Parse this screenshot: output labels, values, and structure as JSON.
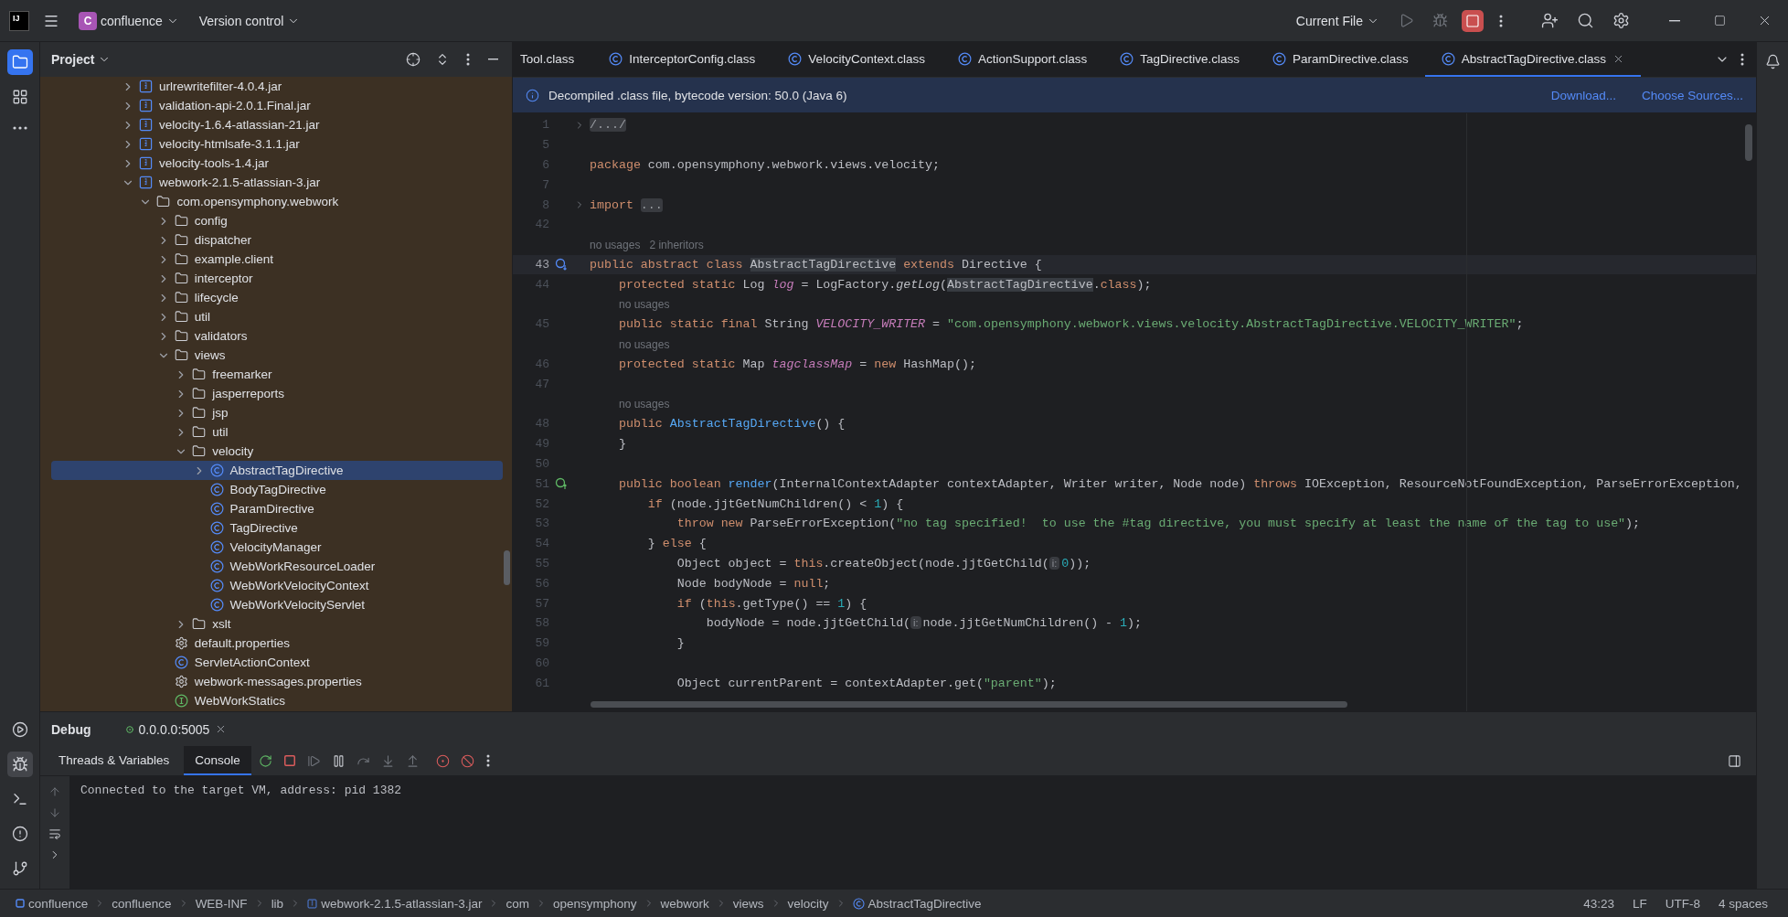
{
  "title_bar": {
    "logo": "IJ",
    "project_initial": "C",
    "project": "confluence",
    "vcs": "Version control",
    "run_config": "Current File"
  },
  "project_panel": {
    "title": "Project",
    "tree": [
      {
        "label": "urlrewritefilter-4.0.4.jar",
        "kind": "jar",
        "expanded": false,
        "selected": false
      },
      {
        "label": "validation-api-2.0.1.Final.jar",
        "kind": "jar",
        "expanded": false,
        "selected": false
      },
      {
        "label": "velocity-1.6.4-atlassian-21.jar",
        "kind": "jar",
        "expanded": false,
        "selected": false
      },
      {
        "label": "velocity-htmlsafe-3.1.1.jar",
        "kind": "jar",
        "expanded": false,
        "selected": false
      },
      {
        "label": "velocity-tools-1.4.jar",
        "kind": "jar",
        "expanded": false,
        "selected": false
      },
      {
        "label": "webwork-2.1.5-atlassian-3.jar",
        "kind": "jar",
        "expanded": true,
        "selected": false,
        "children": [
          {
            "label": "com.opensymphony.webwork",
            "kind": "package",
            "expanded": true,
            "selected": false,
            "children": [
              {
                "label": "config",
                "kind": "package",
                "expanded": false,
                "selected": false
              },
              {
                "label": "dispatcher",
                "kind": "package",
                "expanded": false,
                "selected": false
              },
              {
                "label": "example.client",
                "kind": "package",
                "expanded": false,
                "selected": false
              },
              {
                "label": "interceptor",
                "kind": "package",
                "expanded": false,
                "selected": false
              },
              {
                "label": "lifecycle",
                "kind": "package",
                "expanded": false,
                "selected": false
              },
              {
                "label": "util",
                "kind": "package",
                "expanded": false,
                "selected": false
              },
              {
                "label": "validators",
                "kind": "package",
                "expanded": false,
                "selected": false
              },
              {
                "label": "views",
                "kind": "package",
                "expanded": true,
                "selected": false,
                "children": [
                  {
                    "label": "freemarker",
                    "kind": "package",
                    "expanded": false,
                    "selected": false
                  },
                  {
                    "label": "jasperreports",
                    "kind": "package",
                    "expanded": false,
                    "selected": false
                  },
                  {
                    "label": "jsp",
                    "kind": "package",
                    "expanded": false,
                    "selected": false
                  },
                  {
                    "label": "util",
                    "kind": "package",
                    "expanded": false,
                    "selected": false
                  },
                  {
                    "label": "velocity",
                    "kind": "package",
                    "expanded": true,
                    "selected": false,
                    "children": [
                      {
                        "label": "AbstractTagDirective",
                        "kind": "class",
                        "expanded": false,
                        "selected": true
                      },
                      {
                        "label": "BodyTagDirective",
                        "kind": "class",
                        "selected": false
                      },
                      {
                        "label": "ParamDirective",
                        "kind": "class",
                        "selected": false
                      },
                      {
                        "label": "TagDirective",
                        "kind": "class",
                        "selected": false
                      },
                      {
                        "label": "VelocityManager",
                        "kind": "class",
                        "selected": false
                      },
                      {
                        "label": "WebWorkResourceLoader",
                        "kind": "class",
                        "selected": false
                      },
                      {
                        "label": "WebWorkVelocityContext",
                        "kind": "class",
                        "selected": false
                      },
                      {
                        "label": "WebWorkVelocityServlet",
                        "kind": "class",
                        "selected": false
                      }
                    ]
                  },
                  {
                    "label": "xslt",
                    "kind": "package",
                    "expanded": false,
                    "selected": false
                  }
                ]
              },
              {
                "label": "default.properties",
                "kind": "properties",
                "selected": false
              },
              {
                "label": "ServletActionContext",
                "kind": "class",
                "selected": false
              },
              {
                "label": "webwork-messages.properties",
                "kind": "properties",
                "selected": false
              },
              {
                "label": "WebWorkStatics",
                "kind": "interface",
                "selected": false
              }
            ]
          }
        ]
      }
    ]
  },
  "editor": {
    "tabs": [
      {
        "label": "Tool.class",
        "kind": "partial",
        "selected": false
      },
      {
        "label": "InterceptorConfig.class",
        "kind": "class",
        "selected": false
      },
      {
        "label": "VelocityContext.class",
        "kind": "class",
        "selected": false
      },
      {
        "label": "ActionSupport.class",
        "kind": "class",
        "selected": false
      },
      {
        "label": "TagDirective.class",
        "kind": "class",
        "selected": false
      },
      {
        "label": "ParamDirective.class",
        "kind": "class",
        "selected": false
      },
      {
        "label": "AbstractTagDirective.class",
        "kind": "class",
        "selected": true
      }
    ],
    "banner": {
      "message": "Decompiled .class file, bytecode version: 50.0 (Java 6)",
      "links": [
        "Download...",
        "Choose Sources..."
      ]
    },
    "lines": [
      {
        "kind": "code",
        "number": "1",
        "current": false,
        "tokens": [
          {
            "kind": "folded",
            "text": "/.../"
          }
        ]
      },
      {
        "kind": "code",
        "number": "5",
        "current": false
      },
      {
        "kind": "code",
        "number": "6",
        "current": false,
        "tokens": [
          {
            "kind": "keyword",
            "text": "package "
          },
          {
            "kind": "plain",
            "text": "com.opensymphony.webwork.views.velocity;"
          }
        ]
      },
      {
        "kind": "code",
        "number": "7",
        "current": false
      },
      {
        "kind": "code",
        "number": "8",
        "current": false,
        "tokens": [
          {
            "kind": "keyword",
            "text": "import "
          },
          {
            "kind": "folded",
            "text": "..."
          }
        ]
      },
      {
        "kind": "code",
        "number": "42",
        "current": false
      },
      {
        "kind": "hint",
        "nested": false,
        "texts": [
          "no usages",
          "2 inheritors"
        ]
      },
      {
        "kind": "implemented",
        "number": "43",
        "current": true,
        "tokens": [
          {
            "kind": "keyword",
            "text": "public abstract class "
          },
          {
            "kind": "match",
            "text": "AbstractTagDirective"
          },
          {
            "kind": "keyword",
            "text": " extends "
          },
          {
            "kind": "plain",
            "text": "Directive {"
          }
        ]
      },
      {
        "kind": "code",
        "number": "44",
        "current": false,
        "tokens": [
          {
            "kind": "keyword",
            "text": "    protected static "
          },
          {
            "kind": "plain",
            "text": "Log "
          },
          {
            "kind": "field",
            "text": "log"
          },
          {
            "kind": "plain",
            "text": " = LogFactory."
          },
          {
            "kind": "static_call",
            "text": "getLog"
          },
          {
            "kind": "plain",
            "text": "("
          },
          {
            "kind": "match",
            "text": "AbstractTagDirective"
          },
          {
            "kind": "plain",
            "text": "."
          },
          {
            "kind": "keyword",
            "text": "class"
          },
          {
            "kind": "plain",
            "text": ");"
          }
        ]
      },
      {
        "kind": "hint",
        "nested": true,
        "texts": [
          "no usages"
        ]
      },
      {
        "kind": "code",
        "number": "45",
        "current": false,
        "tokens": [
          {
            "kind": "keyword",
            "text": "    public static final "
          },
          {
            "kind": "plain",
            "text": "String "
          },
          {
            "kind": "field",
            "text": "VELOCITY_WRITER"
          },
          {
            "kind": "plain",
            "text": " = "
          },
          {
            "kind": "string",
            "text": "\"com.opensymphony.webwork.views.velocity.AbstractTagDirective.VELOCITY_WRITER\""
          },
          {
            "kind": "plain",
            "text": ";"
          }
        ]
      },
      {
        "kind": "hint",
        "nested": true,
        "texts": [
          "no usages"
        ]
      },
      {
        "kind": "code",
        "number": "46",
        "current": false,
        "tokens": [
          {
            "kind": "keyword",
            "text": "    protected static "
          },
          {
            "kind": "plain",
            "text": "Map "
          },
          {
            "kind": "field",
            "text": "tagclassMap"
          },
          {
            "kind": "plain",
            "text": " = "
          },
          {
            "kind": "keyword",
            "text": "new "
          },
          {
            "kind": "plain",
            "text": "HashMap();"
          }
        ]
      },
      {
        "kind": "code",
        "number": "47",
        "current": false
      },
      {
        "kind": "hint",
        "nested": true,
        "texts": [
          "no usages"
        ]
      },
      {
        "kind": "code",
        "number": "48",
        "current": false,
        "tokens": [
          {
            "kind": "keyword",
            "text": "    public "
          },
          {
            "kind": "declaration",
            "text": "AbstractTagDirective"
          },
          {
            "kind": "plain",
            "text": "() {"
          }
        ]
      },
      {
        "kind": "code",
        "number": "49",
        "current": false,
        "tokens": [
          {
            "kind": "plain",
            "text": "    }"
          }
        ]
      },
      {
        "kind": "code",
        "number": "50",
        "current": false
      },
      {
        "kind": "overridable",
        "number": "51",
        "current": false,
        "tokens": [
          {
            "kind": "keyword",
            "text": "    public boolean "
          },
          {
            "kind": "declaration",
            "text": "render"
          },
          {
            "kind": "plain",
            "text": "(InternalContextAdapter contextAdapter, Writer writer, Node node) "
          },
          {
            "kind": "keyword",
            "text": "throws "
          },
          {
            "kind": "plain",
            "text": "IOException, ResourceNotFoundException, ParseErrorException,"
          }
        ]
      },
      {
        "kind": "code",
        "number": "52",
        "current": false,
        "tokens": [
          {
            "kind": "keyword",
            "text": "        if "
          },
          {
            "kind": "plain",
            "text": "(node.jjtGetNumChildren() < "
          },
          {
            "kind": "number",
            "text": "1"
          },
          {
            "kind": "plain",
            "text": ") {"
          }
        ]
      },
      {
        "kind": "code",
        "number": "53",
        "current": false,
        "tokens": [
          {
            "kind": "keyword",
            "text": "            throw new "
          },
          {
            "kind": "plain",
            "text": "ParseErrorException("
          },
          {
            "kind": "string",
            "text": "\"no tag specified!  to use the #tag directive, you must specify at least the name of the tag to use\""
          },
          {
            "kind": "plain",
            "text": ");"
          }
        ]
      },
      {
        "kind": "code",
        "number": "54",
        "current": false,
        "tokens": [
          {
            "kind": "plain",
            "text": "        } "
          },
          {
            "kind": "keyword",
            "text": "else "
          },
          {
            "kind": "plain",
            "text": "{"
          }
        ]
      },
      {
        "kind": "code",
        "number": "55",
        "current": false,
        "tokens": [
          {
            "kind": "plain",
            "text": "            Object object = "
          },
          {
            "kind": "keyword",
            "text": "this"
          },
          {
            "kind": "plain",
            "text": ".createObject(node.jjtGetChild("
          },
          {
            "kind": "param_hint",
            "text": "i:"
          },
          {
            "kind": "number",
            "text": "0"
          },
          {
            "kind": "plain",
            "text": "));"
          }
        ]
      },
      {
        "kind": "code",
        "number": "56",
        "current": false,
        "tokens": [
          {
            "kind": "plain",
            "text": "            Node bodyNode = "
          },
          {
            "kind": "keyword",
            "text": "null"
          },
          {
            "kind": "plain",
            "text": ";"
          }
        ]
      },
      {
        "kind": "code",
        "number": "57",
        "current": false,
        "tokens": [
          {
            "kind": "keyword",
            "text": "            if "
          },
          {
            "kind": "plain",
            "text": "("
          },
          {
            "kind": "keyword",
            "text": "this"
          },
          {
            "kind": "plain",
            "text": ".getType() == "
          },
          {
            "kind": "number",
            "text": "1"
          },
          {
            "kind": "plain",
            "text": ") {"
          }
        ]
      },
      {
        "kind": "code",
        "number": "58",
        "current": false,
        "tokens": [
          {
            "kind": "plain",
            "text": "                bodyNode = node.jjtGetChild("
          },
          {
            "kind": "param_hint",
            "text": "i:"
          },
          {
            "kind": "plain",
            "text": "node.jjtGetNumChildren() - "
          },
          {
            "kind": "number",
            "text": "1"
          },
          {
            "kind": "plain",
            "text": ");"
          }
        ]
      },
      {
        "kind": "code",
        "number": "59",
        "current": false,
        "tokens": [
          {
            "kind": "plain",
            "text": "            }"
          }
        ]
      },
      {
        "kind": "code",
        "number": "60",
        "current": false
      },
      {
        "kind": "code",
        "number": "61",
        "current": false,
        "tokens": [
          {
            "kind": "plain",
            "text": "            Object currentParent = contextAdapter.get("
          },
          {
            "kind": "string",
            "text": "\"parent\""
          },
          {
            "kind": "plain",
            "text": ");"
          }
        ]
      }
    ]
  },
  "debug": {
    "title": "Debug",
    "session": "0.0.0.0:5005",
    "tabs": [
      {
        "label": "Threads & Variables",
        "selected": false
      },
      {
        "label": "Console",
        "selected": true
      }
    ],
    "console": [
      "Connected to the target VM, address: pid 1382"
    ]
  },
  "status_bar": {
    "breadcrumbs": [
      {
        "label": "confluence",
        "kind": "module"
      },
      {
        "label": "confluence",
        "kind": "folder"
      },
      {
        "label": "WEB-INF",
        "kind": "folder"
      },
      {
        "label": "lib",
        "kind": "folder"
      },
      {
        "label": "webwork-2.1.5-atlassian-3.jar",
        "kind": "jar"
      },
      {
        "label": "com",
        "kind": "folder"
      },
      {
        "label": "opensymphony",
        "kind": "folder"
      },
      {
        "label": "webwork",
        "kind": "folder"
      },
      {
        "label": "views",
        "kind": "folder"
      },
      {
        "label": "velocity",
        "kind": "folder"
      },
      {
        "label": "AbstractTagDirective",
        "kind": "class"
      }
    ],
    "position": "43:23",
    "line_separator": "LF",
    "encoding": "UTF-8",
    "indent": "4 spaces"
  }
}
